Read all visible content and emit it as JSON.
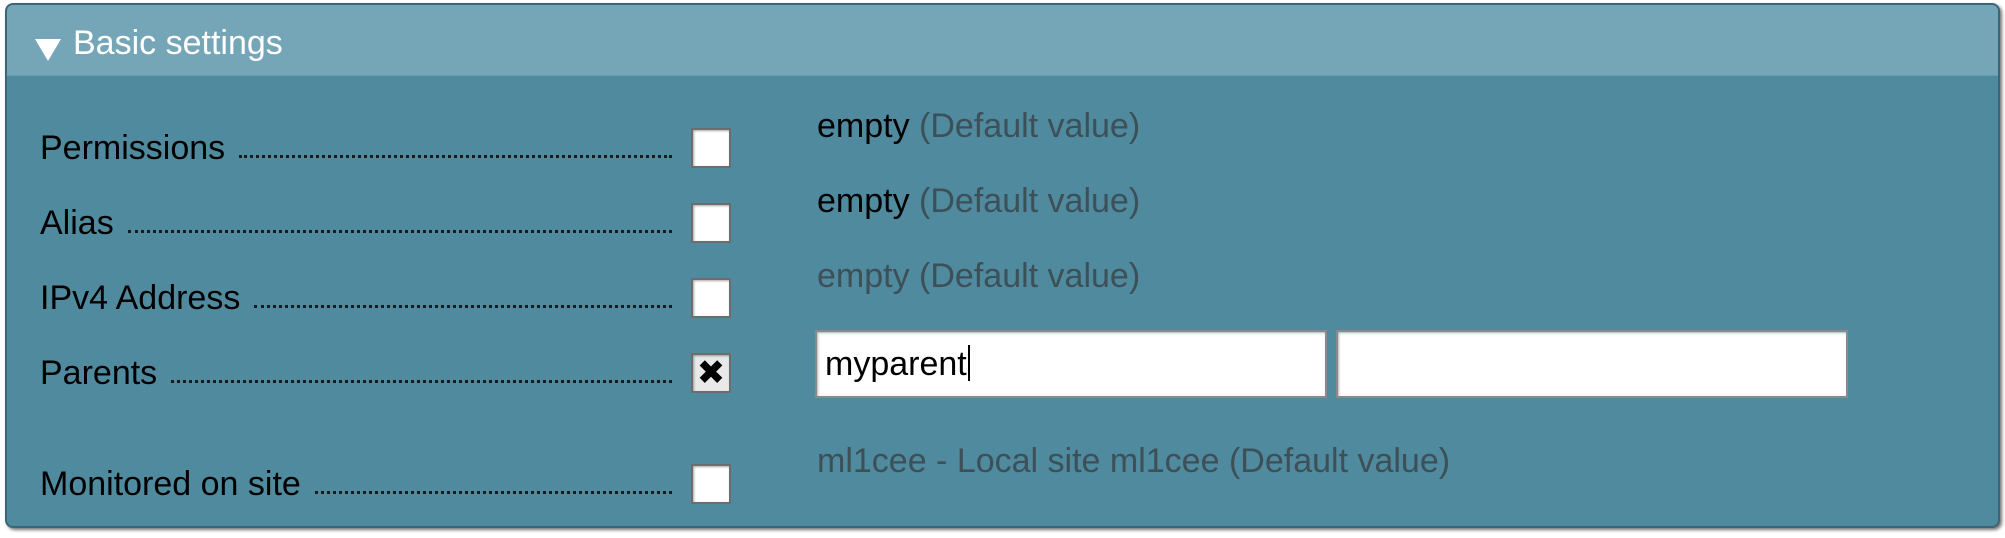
{
  "panel": {
    "title": "Basic settings",
    "expanded": true,
    "header_icon": "triangle-down-icon"
  },
  "rows": [
    {
      "label": "Permissions",
      "checked": false,
      "value": "empty",
      "default_suffix": "(Default value)"
    },
    {
      "label": "Alias",
      "checked": false,
      "value": "empty",
      "default_suffix": "(Default value)"
    },
    {
      "label": "IPv4 Address",
      "checked": false,
      "value": "empty",
      "default_suffix": "(Default value)"
    },
    {
      "label": "Parents",
      "checked": true,
      "inputs": [
        {
          "value": "myparent"
        },
        {
          "value": ""
        }
      ]
    },
    {
      "label": "Monitored on site",
      "checked": false,
      "value": "ml1cee - Local site ml1cee",
      "default_suffix": "(Default value)"
    }
  ],
  "colors": {
    "panel_bg": "#4f8a9f",
    "header_bg": "#75a6b8",
    "default_text": "#3d4f57"
  }
}
